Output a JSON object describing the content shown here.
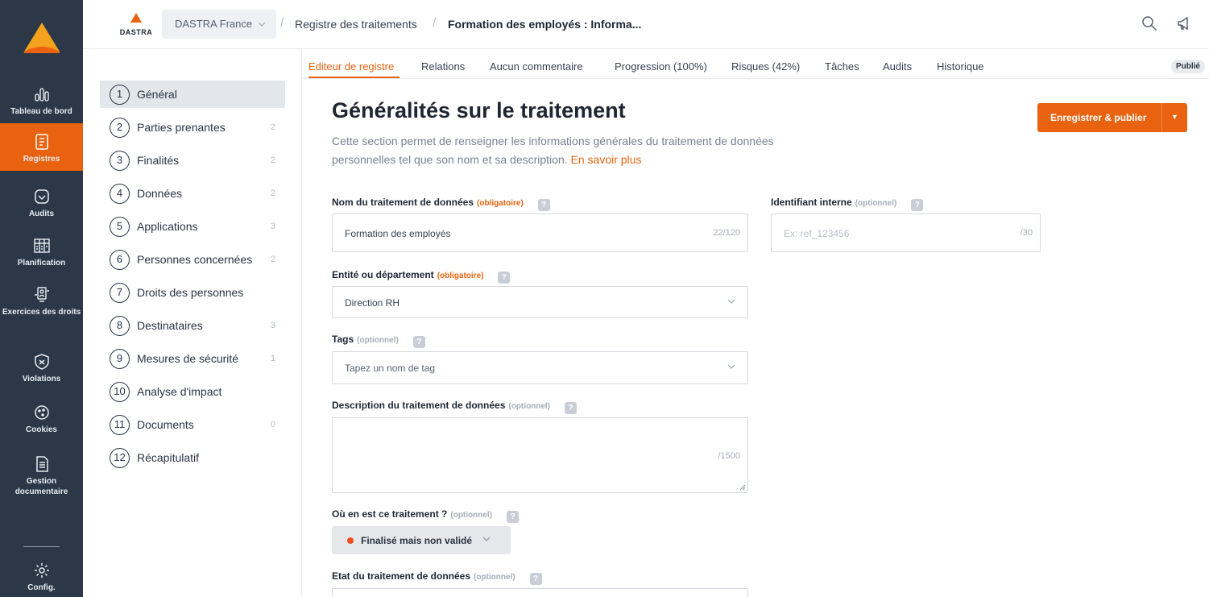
{
  "colors": {
    "accent": "#e8620f",
    "rail": "#2c3848",
    "status_dot": "#f04e23"
  },
  "rail": {
    "items": [
      {
        "label": "Tableau de bord",
        "icon": "bar-chart-icon"
      },
      {
        "label": "Registres",
        "icon": "register-icon",
        "active": true
      },
      {
        "label": "Audits",
        "icon": "shield-check-icon"
      },
      {
        "label": "Planification",
        "icon": "calendar-icon"
      },
      {
        "label": "Exercices des droits",
        "icon": "person-id-icon"
      },
      {
        "label": "Violations",
        "icon": "alert-shield-icon"
      },
      {
        "label": "Cookies",
        "icon": "cookie-icon"
      },
      {
        "label": "Gestion documentaire",
        "icon": "document-icon"
      },
      {
        "label": "Config.",
        "icon": "gear-icon"
      }
    ]
  },
  "topbar": {
    "brand": "DASTRA",
    "org": "DASTRA France",
    "breadcrumb": [
      "Registre des traitements",
      "Formation des employés : Informa..."
    ],
    "icons": [
      "search-icon",
      "megaphone-icon"
    ]
  },
  "steps": [
    {
      "num": "1",
      "label": "Général",
      "count": "",
      "active": true
    },
    {
      "num": "2",
      "label": "Parties prenantes",
      "count": "2"
    },
    {
      "num": "3",
      "label": "Finalités",
      "count": "2"
    },
    {
      "num": "4",
      "label": "Données",
      "count": "2"
    },
    {
      "num": "5",
      "label": "Applications",
      "count": "3"
    },
    {
      "num": "6",
      "label": "Personnes concernées",
      "count": "2"
    },
    {
      "num": "7",
      "label": "Droits des personnes",
      "count": ""
    },
    {
      "num": "8",
      "label": "Destinataires",
      "count": "3"
    },
    {
      "num": "9",
      "label": "Mesures de sécurité",
      "count": "1"
    },
    {
      "num": "10",
      "label": "Analyse d'impact",
      "count": ""
    },
    {
      "num": "11",
      "label": "Documents",
      "count": "0"
    },
    {
      "num": "12",
      "label": "Récapitulatif",
      "count": ""
    }
  ],
  "tabs": {
    "items": [
      "Editeur de registre",
      "Relations",
      "Aucun commentaire",
      "Progression (100%)",
      "Risques (42%)",
      "Tâches",
      "Audits",
      "Historique"
    ],
    "status_badge": "Publié"
  },
  "main": {
    "title": "Généralités sur le traitement",
    "subtitle": "Cette section permet de renseigner les informations générales du traitement de données personnelles tel que son nom et sa description.",
    "learn_more": "En savoir plus",
    "publish_label": "Enregistrer & publier",
    "help_glyph": "?"
  },
  "form": {
    "name": {
      "label": "Nom du traitement de données",
      "tag": "(obligatoire)",
      "value": "Formation des employés",
      "counter": "22/120"
    },
    "internal_id": {
      "label": "Identifiant interne",
      "tag": "(optionnel)",
      "placeholder": "Ex: ref_123456",
      "counter": "/30"
    },
    "entity": {
      "label": "Entité ou département",
      "tag": "(obligatoire)",
      "value": "Direction RH"
    },
    "tags": {
      "label": "Tags",
      "tag": "(optionnel)",
      "placeholder": "Tapez un nom de tag"
    },
    "description": {
      "label": "Description du traitement de données",
      "tag": "(optionnel)",
      "counter": "/1500"
    },
    "status": {
      "label": "Où en est ce traitement ?",
      "tag": "(optionnel)",
      "value": "Finalisé mais non validé"
    },
    "state": {
      "label": "Etat du traitement de données",
      "tag": "(optionnel)"
    }
  }
}
